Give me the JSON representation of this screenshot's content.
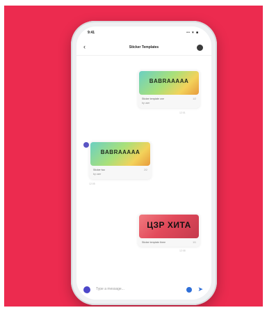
{
  "status": {
    "time": "9:41",
    "signal": "•• ▾ ■"
  },
  "header": {
    "title": "Sticker Templates"
  },
  "messages": [
    {
      "from": "me",
      "sticker_text": "BABRAAAAA",
      "caption": "Sticker template one",
      "caption2": "by user",
      "meta": "1/2",
      "time": "12:01"
    },
    {
      "from": "other",
      "sticker_text": "BABRAAAAA",
      "caption": "Sticker two",
      "caption2": "by user",
      "meta": "2/2",
      "time": "12:05"
    },
    {
      "from": "me",
      "sticker_text": "ЦЗР XИТА",
      "caption": "Sticker template three",
      "meta": "1/1",
      "time": "12:08"
    }
  ],
  "composer": {
    "placeholder": "Type a message..."
  }
}
